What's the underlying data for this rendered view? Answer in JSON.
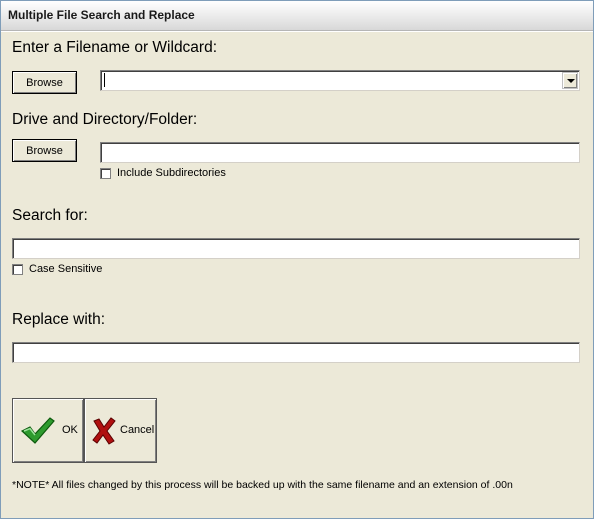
{
  "window": {
    "title": "Multiple File Search and Replace"
  },
  "filename": {
    "label": "Enter a Filename or Wildcard:",
    "browse_label": "Browse",
    "value": ""
  },
  "directory": {
    "label": "Drive and Directory/Folder:",
    "browse_label": "Browse",
    "value": "",
    "include_subdirs_label": "Include Subdirectories",
    "include_subdirs_checked": false
  },
  "search": {
    "label": "Search for:",
    "value": "",
    "case_sensitive_label": "Case Sensitive",
    "case_sensitive_checked": false
  },
  "replace": {
    "label": "Replace with:",
    "value": ""
  },
  "actions": {
    "ok_label": "OK",
    "cancel_label": "Cancel",
    "ok_icon": "green-checkmark-icon",
    "cancel_icon": "red-x-icon"
  },
  "note": "*NOTE*  All files changed by this process will be backed up with the same filename and an extension of .00n",
  "colors": {
    "background": "#ece9d8",
    "ok_check": "#2e9b2e",
    "cancel_x": "#b01010"
  }
}
